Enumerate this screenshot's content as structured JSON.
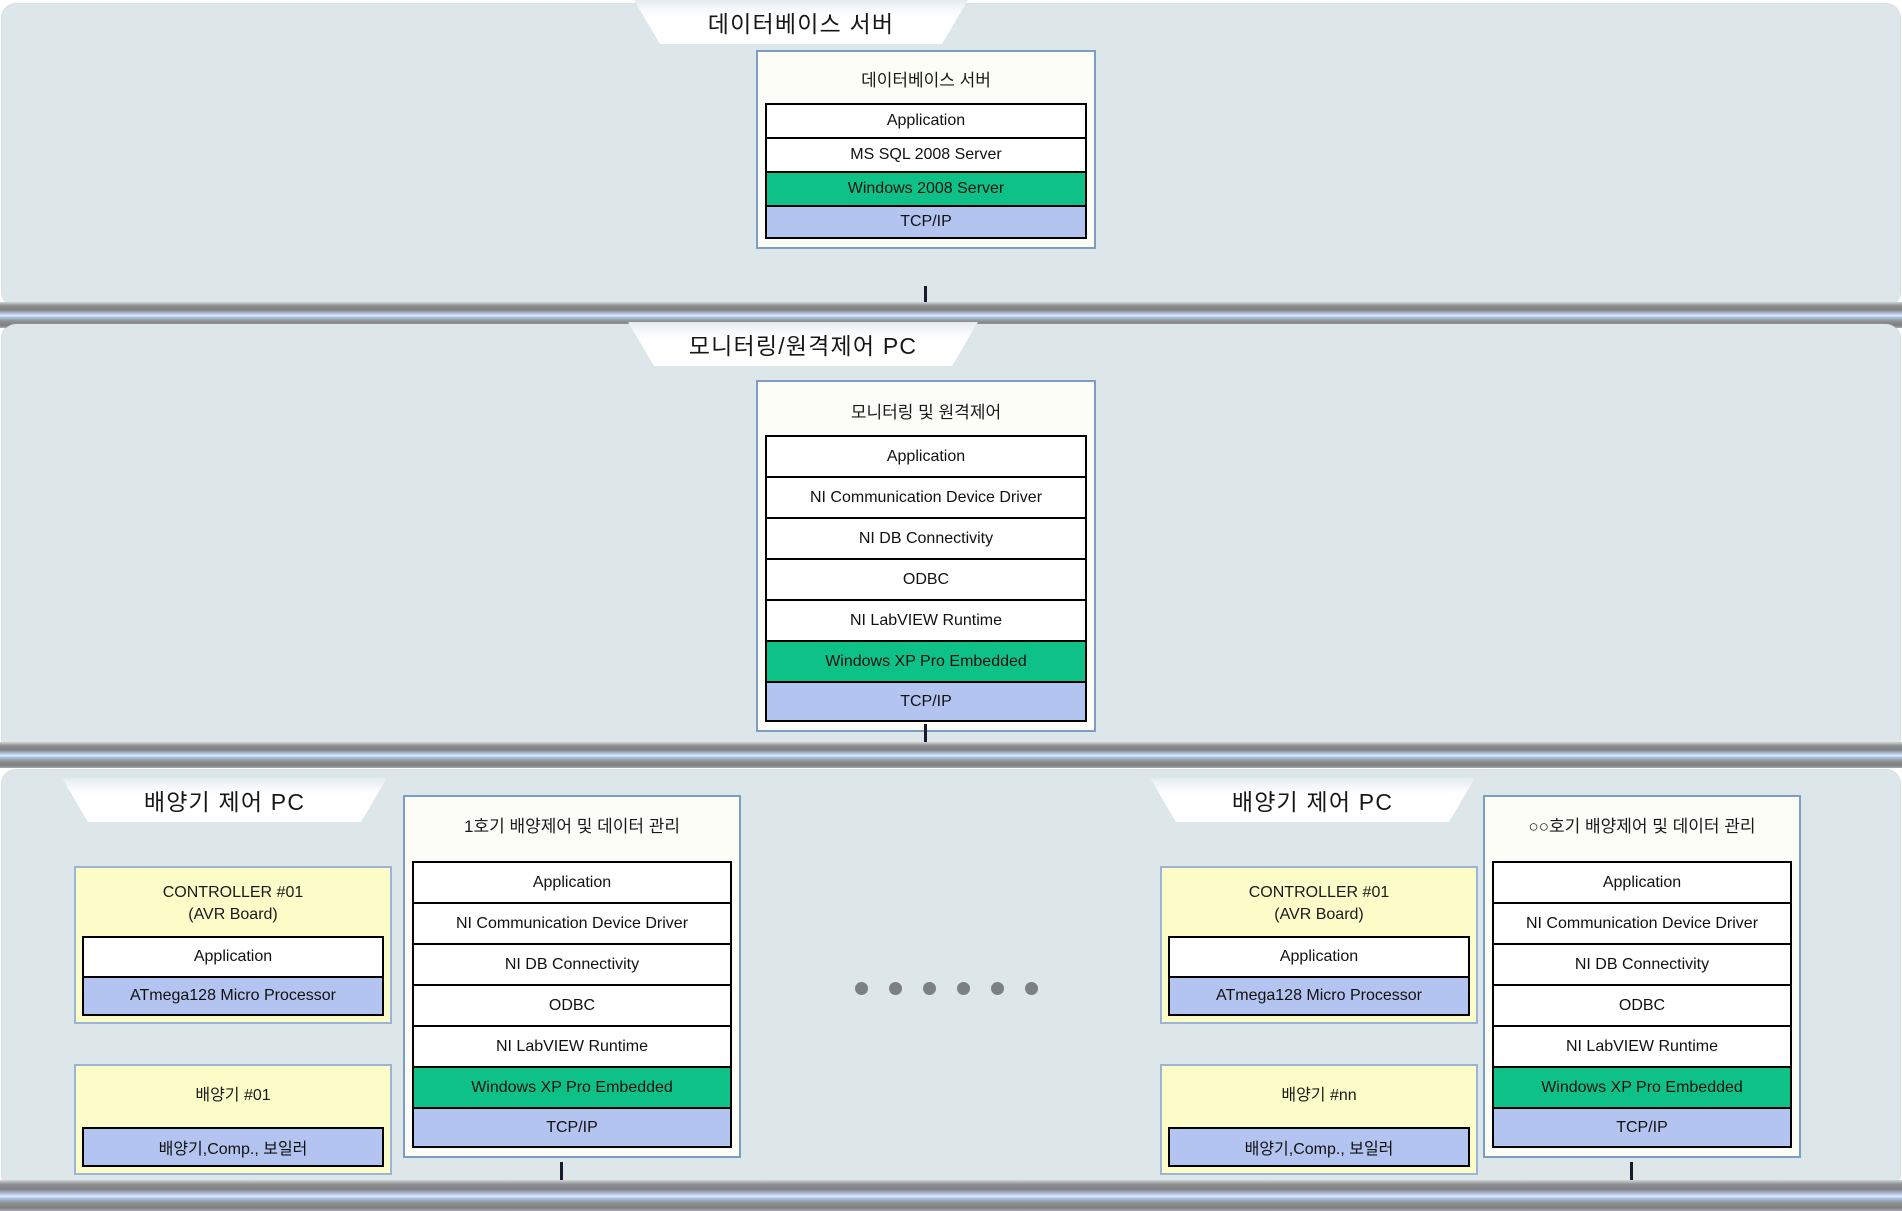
{
  "sections": {
    "database": {
      "banner": "데이터베이스 서버",
      "card_title": "데이터베이스 서버",
      "layers": [
        {
          "label": "Application",
          "kind": "app"
        },
        {
          "label": "MS SQL 2008 Server",
          "kind": "app"
        },
        {
          "label": "Windows 2008 Server",
          "kind": "os"
        },
        {
          "label": "TCP/IP",
          "kind": "net"
        }
      ]
    },
    "monitoring": {
      "banner": "모니터링/원격제어 PC",
      "card_title": "모니터링 및 원격제어",
      "layers": [
        {
          "label": "Application",
          "kind": "app"
        },
        {
          "label": "NI Communication Device Driver",
          "kind": "app"
        },
        {
          "label": "NI DB Connectivity",
          "kind": "app"
        },
        {
          "label": "ODBC",
          "kind": "app"
        },
        {
          "label": "NI LabVIEW Runtime",
          "kind": "app"
        },
        {
          "label": "Windows XP Pro Embedded",
          "kind": "os"
        },
        {
          "label": "TCP/IP",
          "kind": "net"
        }
      ]
    },
    "controller_left": {
      "banner": "배양기 제어 PC",
      "controller": {
        "title": "CONTROLLER #01",
        "subtitle": "(AVR Board)",
        "rows": [
          {
            "label": "Application",
            "kind": "app"
          },
          {
            "label": "ATmega128 Micro Processor",
            "kind": "hw"
          }
        ]
      },
      "device": {
        "title": "배양기 #01",
        "rows": [
          {
            "label": "배양기,Comp., 보일러",
            "kind": "hw"
          }
        ]
      },
      "stack": {
        "card_title": "1호기 배양제어 및 데이터 관리",
        "layers": [
          {
            "label": "Application",
            "kind": "app"
          },
          {
            "label": "NI Communication Device Driver",
            "kind": "app"
          },
          {
            "label": "NI DB Connectivity",
            "kind": "app"
          },
          {
            "label": "ODBC",
            "kind": "app"
          },
          {
            "label": "NI LabVIEW Runtime",
            "kind": "app"
          },
          {
            "label": "Windows XP Pro Embedded",
            "kind": "os"
          },
          {
            "label": "TCP/IP",
            "kind": "net"
          }
        ]
      }
    },
    "controller_right": {
      "banner": "배양기 제어 PC",
      "controller": {
        "title": "CONTROLLER #01",
        "subtitle": "(AVR Board)",
        "rows": [
          {
            "label": "Application",
            "kind": "app"
          },
          {
            "label": "ATmega128 Micro Processor",
            "kind": "hw"
          }
        ]
      },
      "device": {
        "title": "배양기 #nn",
        "rows": [
          {
            "label": "배양기,Comp., 보일러",
            "kind": "hw"
          }
        ]
      },
      "stack": {
        "card_title": "○○호기 배양제어 및 데이터 관리",
        "layers": [
          {
            "label": "Application",
            "kind": "app"
          },
          {
            "label": "NI Communication Device Driver",
            "kind": "app"
          },
          {
            "label": "NI DB Connectivity",
            "kind": "app"
          },
          {
            "label": "ODBC",
            "kind": "app"
          },
          {
            "label": "NI LabVIEW Runtime",
            "kind": "app"
          },
          {
            "label": "Windows XP Pro Embedded",
            "kind": "os"
          },
          {
            "label": "TCP/IP",
            "kind": "net"
          }
        ]
      }
    }
  },
  "ellipsis": {
    "dot_count": 6
  },
  "colors": {
    "panel_background": "#dde7e9",
    "os_layer": "#0ec287",
    "network_layer": "#b2c4ef",
    "device_box": "#fcfcc9",
    "card_border": "#7d9dc4",
    "dot": "#7c7f84"
  }
}
